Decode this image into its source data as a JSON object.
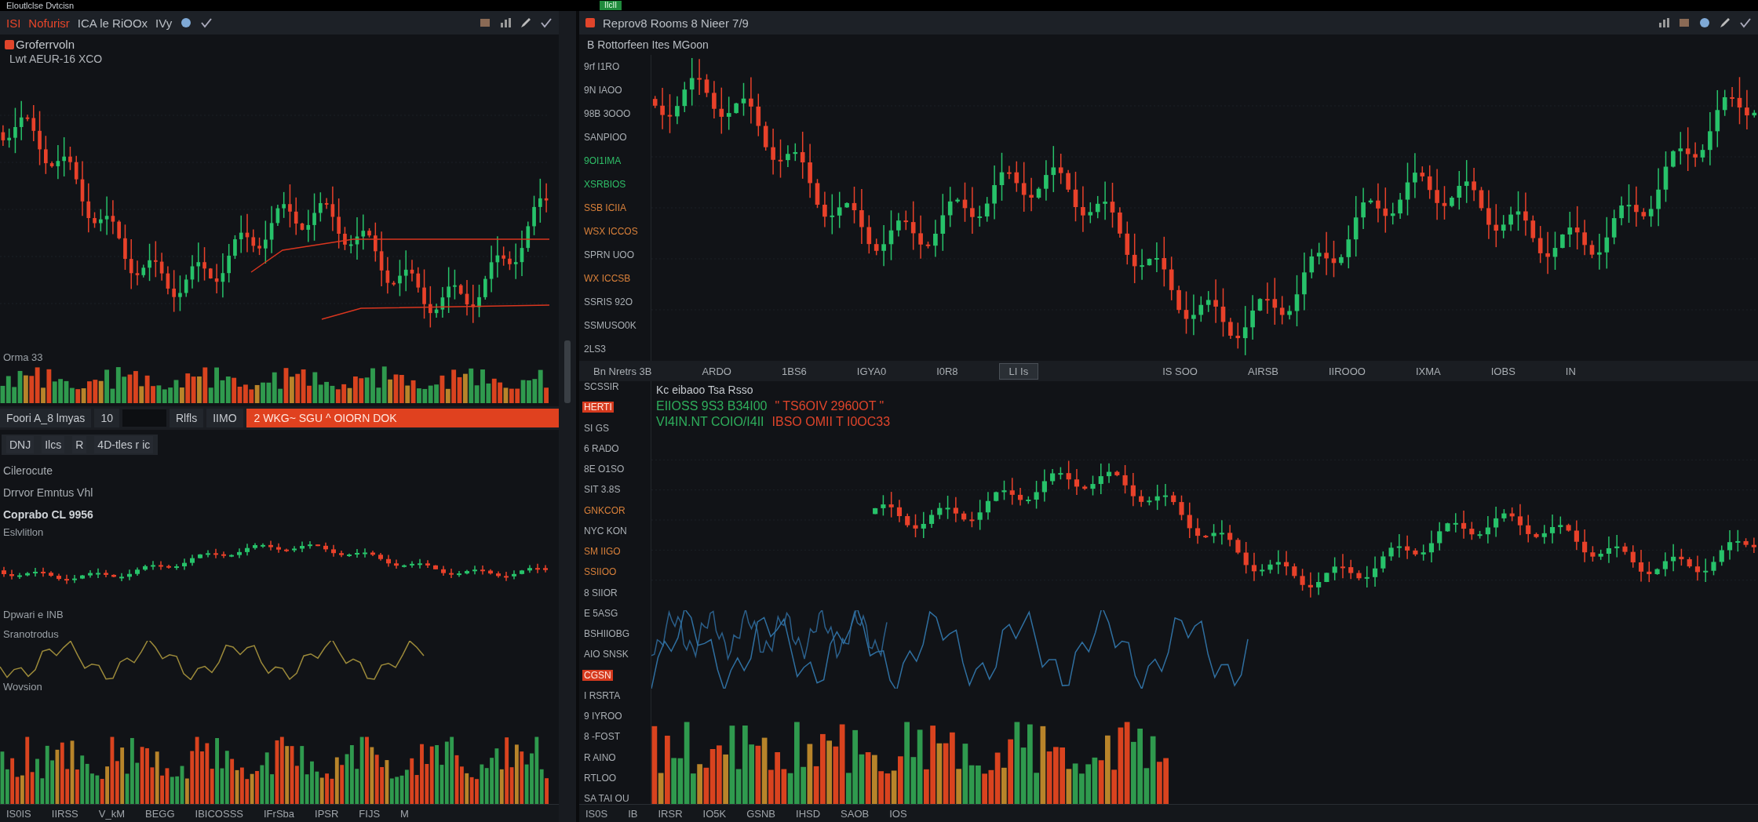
{
  "top_bar": {
    "left_text": "Eloutlclse Dvtcisn",
    "tag": "IIcII"
  },
  "left_panel": {
    "toolbar": {
      "items": [
        {
          "text": "ISI",
          "kind": "alert"
        },
        {
          "text": "Nofurisr",
          "kind": "alert"
        },
        {
          "text": "ICA le RiOOx",
          "kind": "plain"
        },
        {
          "text": "IVy",
          "kind": "plain"
        }
      ]
    },
    "header": {
      "title": "Groferrvoln",
      "subtitle": "Lwt AEUR-16 XCO"
    },
    "volume_label": "Orma 33",
    "tab_row": {
      "items": [
        {
          "label": "Foori A_8 lmyas"
        },
        {
          "label": "10"
        },
        {
          "label": "Rlfls"
        },
        {
          "label": "IIMO"
        }
      ],
      "alert": "2   WKG~  SGU ^ OIORN DOK"
    },
    "filter_row": [
      "DNJ",
      "Ilcs",
      "R",
      "4D-tles r ic"
    ],
    "info_lines": [
      "Cilerocute",
      "Drrvor Emntus Vhl",
      "Coprabo CL 9956"
    ],
    "pane_labels": [
      "Eslvlitlon",
      "Dpwari e INB",
      "Sranotrodus",
      "Wovsion"
    ],
    "axis_labels": [
      "IS0IS",
      "IIRSS",
      "V_kM",
      "BEGG",
      "IBICOSSS",
      "IFrSba",
      "IPSR",
      "FIJS",
      "M"
    ]
  },
  "right_panel": {
    "toolbar": {
      "title": "Reprov8 Rooms 8 Nieer 7/9"
    },
    "header": "B Rottorfeen Ites MGoon",
    "price_axis_upper": [
      {
        "text": "9rf I1RO",
        "kind": "plain"
      },
      {
        "text": "9N IAOO",
        "kind": "plain"
      },
      {
        "text": "98B 3OOO",
        "kind": "plain"
      },
      {
        "text": "SANPIOO",
        "kind": "plain"
      },
      {
        "text": "9OI1IMA",
        "kind": "green"
      },
      {
        "text": "XSRBIOS",
        "kind": "green"
      },
      {
        "text": "SSB ICIIA",
        "kind": "orange"
      },
      {
        "text": "WSX ICCOS",
        "kind": "orange"
      },
      {
        "text": "SPRN UOO",
        "kind": "plain"
      },
      {
        "text": "WX ICCSB",
        "kind": "orange"
      },
      {
        "text": "SSRIS 92O",
        "kind": "plain"
      },
      {
        "text": "SSMUSO0K",
        "kind": "plain"
      },
      {
        "text": "2LS3",
        "kind": "plain"
      }
    ],
    "divider_bar": [
      {
        "text": "Bn Nretrs 3B",
        "selected": false
      },
      {
        "text": "ARDO",
        "selected": false
      },
      {
        "text": "1BS6",
        "selected": false
      },
      {
        "text": "IGYA0",
        "selected": false
      },
      {
        "text": "I0R8",
        "selected": false
      },
      {
        "text": "LI Is",
        "selected": true
      },
      {
        "text": "IS SOO",
        "selected": false
      },
      {
        "text": "AIRSB",
        "selected": false
      },
      {
        "text": "IIROOO",
        "selected": false
      },
      {
        "text": "IXMA",
        "selected": false
      },
      {
        "text": "IOBS",
        "selected": false
      },
      {
        "text": "IN",
        "selected": false
      }
    ],
    "quote_title": "Kc eibaoo Tsa Rsso",
    "quote_lines": [
      {
        "green": "EIIOSS 9S3 B34I00",
        "red": "\" TS6OIV 2960OT \""
      },
      {
        "green": "VI4IN.NT COIO/I4II",
        "red": "IBSO OMII T I0OC33"
      }
    ],
    "price_axis_lower": [
      {
        "text": "SCSSIR",
        "kind": "plain"
      },
      {
        "text": "HERTI",
        "kind": "badge"
      },
      {
        "text": "SI GS",
        "kind": "plain"
      },
      {
        "text": "6 RADO",
        "kind": "plain"
      },
      {
        "text": "8E O1SO",
        "kind": "plain"
      },
      {
        "text": "SIT 3.8S",
        "kind": "plain"
      },
      {
        "text": "GNKCOR",
        "kind": "orange"
      },
      {
        "text": "NYC KON",
        "kind": "plain"
      },
      {
        "text": "SM IIGO",
        "kind": "orange"
      },
      {
        "text": "SSIIOO",
        "kind": "orange"
      },
      {
        "text": "8 SIIOR",
        "kind": "plain"
      },
      {
        "text": "E 5ASG",
        "kind": "plain"
      },
      {
        "text": "BSHIIOBG",
        "kind": "plain"
      },
      {
        "text": "AIO SNSK",
        "kind": "plain"
      },
      {
        "text": "CGSN",
        "kind": "badge"
      },
      {
        "text": "I RSRTA",
        "kind": "plain"
      },
      {
        "text": "9 IYROO",
        "kind": "plain"
      },
      {
        "text": "8 -FOST",
        "kind": "plain"
      },
      {
        "text": "R AINO",
        "kind": "plain"
      },
      {
        "text": "RTLOO",
        "kind": "plain"
      },
      {
        "text": "SA TAI OU",
        "kind": "plain"
      }
    ],
    "axis_labels": [
      "IS0S",
      "IB",
      "IRSR",
      "IO5K",
      "GSNB",
      "IHSD",
      "SAOB",
      "IOS"
    ]
  }
}
